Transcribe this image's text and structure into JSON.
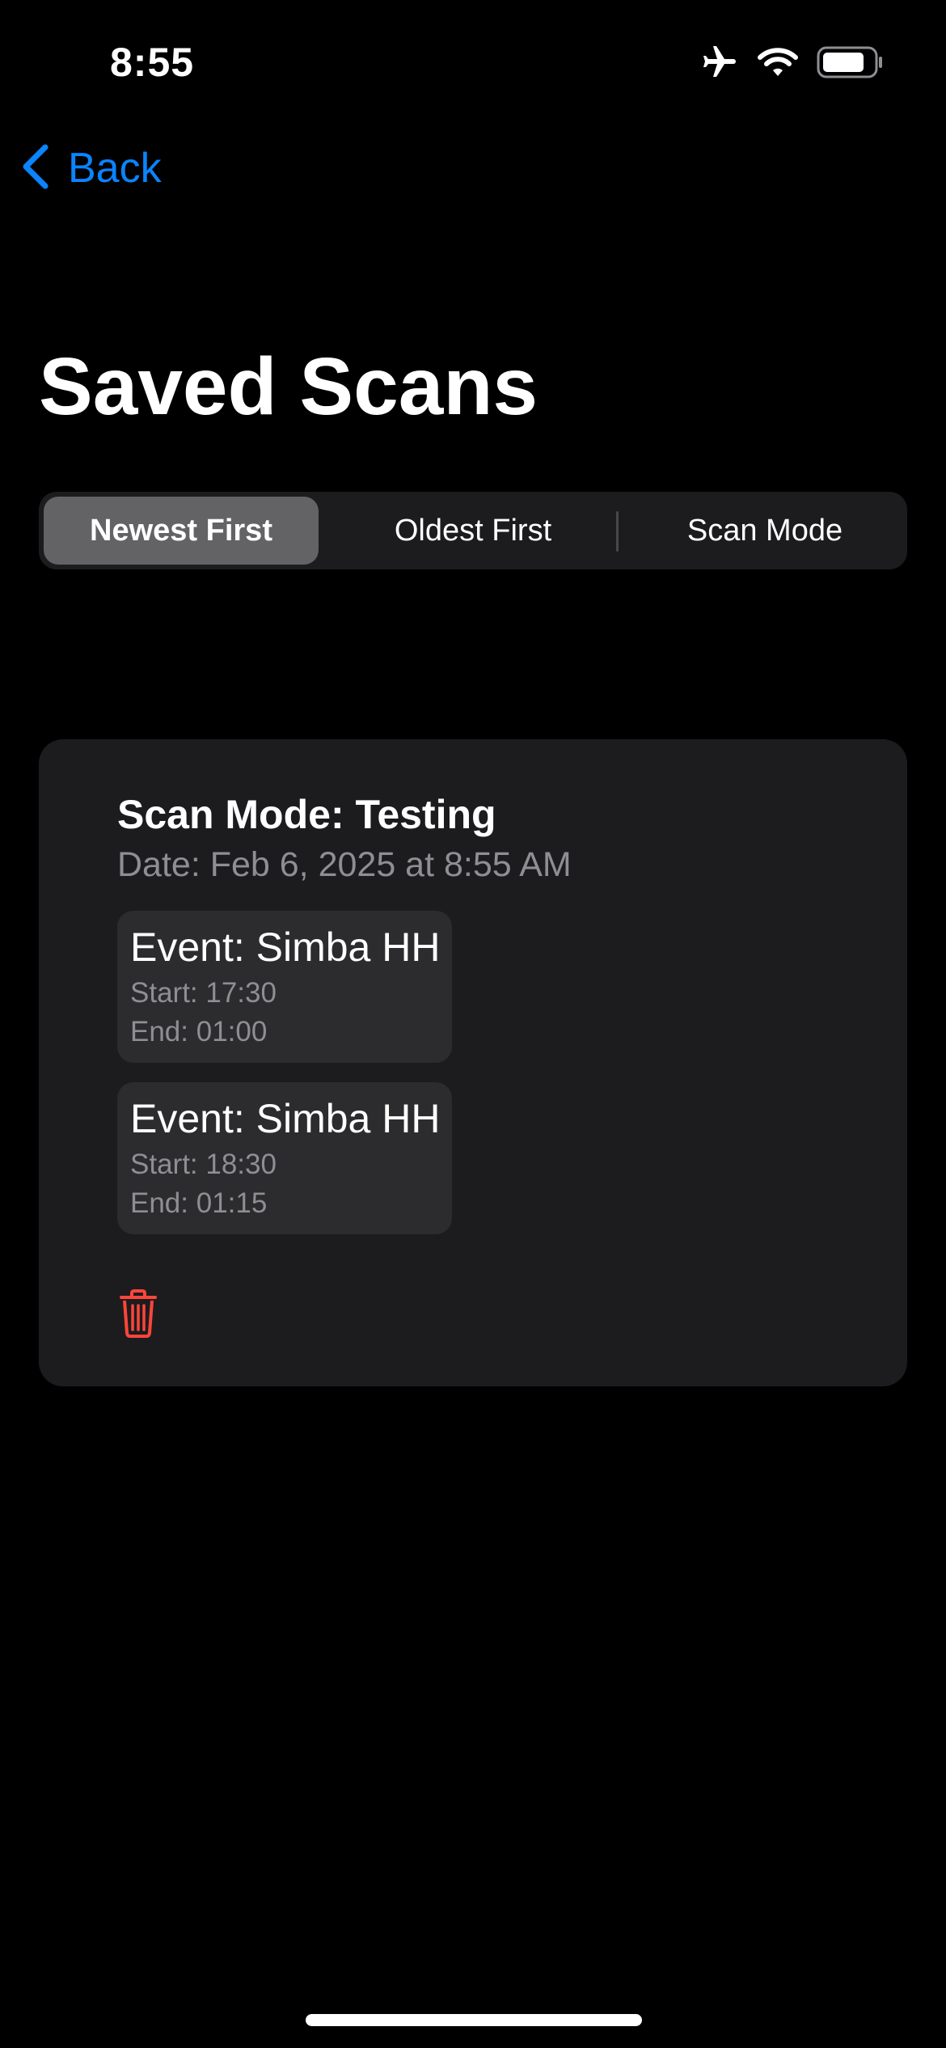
{
  "status_bar": {
    "time": "8:55",
    "icons": [
      "airplane-icon",
      "wifi-icon",
      "battery-icon"
    ],
    "battery_level": 0.8
  },
  "nav": {
    "back_label": "Back",
    "back_icon": "chevron-left-icon"
  },
  "title": "Saved Scans",
  "sort_control": {
    "options": [
      "Newest First",
      "Oldest First",
      "Scan Mode"
    ],
    "selected": "Newest First"
  },
  "scan": {
    "mode": "Scan Mode: Testing",
    "date": "Date: Feb 6, 2025 at 8:55 AM",
    "events": [
      {
        "name": "Event: Simba HH",
        "start": "Start: 17:30",
        "end": "End: 01:00"
      },
      {
        "name": "Event: Simba HH",
        "start": "Start: 18:30",
        "end": "End: 01:15"
      }
    ],
    "delete_icon": "trash-icon"
  },
  "colors": {
    "background": "#000000",
    "accent": "#0A84FF",
    "card": "#1C1C1E",
    "event_card": "#2C2C2E",
    "secondary_text": "#8E8E93",
    "destructive": "#FF453A",
    "segment_selected": "#636366"
  }
}
